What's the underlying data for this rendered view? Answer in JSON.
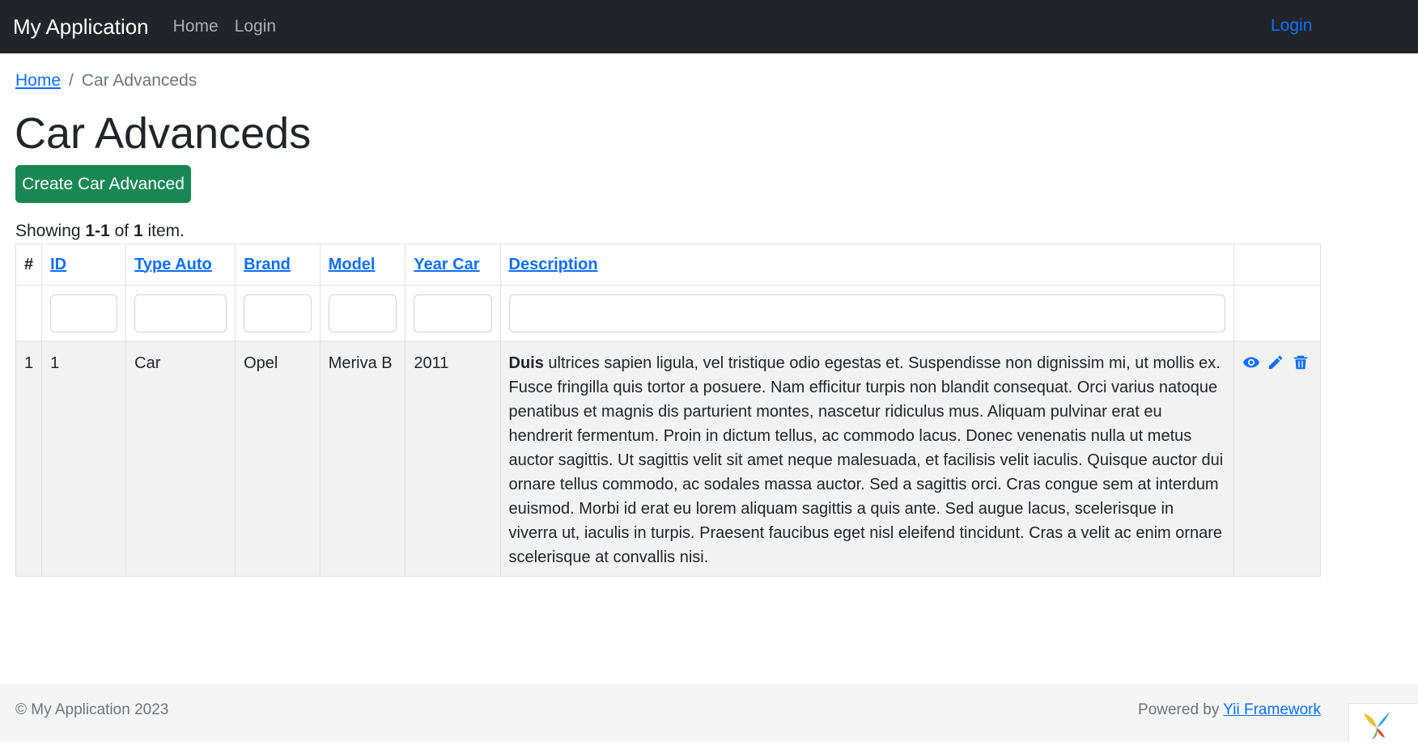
{
  "navbar": {
    "brand": "My Application",
    "links": [
      "Home",
      "Login"
    ],
    "right_login": "Login"
  },
  "breadcrumb": {
    "home": "Home",
    "separator": "/",
    "current": "Car Advanceds"
  },
  "page": {
    "title": "Car Advanceds",
    "create_button": "Create Car Advanced"
  },
  "summary": {
    "prefix": "Showing ",
    "range": "1-1",
    "middle": " of ",
    "total": "1",
    "suffix": " item."
  },
  "table": {
    "columns": [
      "#",
      "ID",
      "Type Auto",
      "Brand",
      "Model",
      "Year Car",
      "Description"
    ],
    "rows": [
      {
        "index": "1",
        "id": "1",
        "type_auto": "Car",
        "brand": "Opel",
        "model": "Meriva B",
        "year_car": "2011",
        "description_bold": "Duis",
        "description_rest": " ultrices sapien ligula, vel tristique odio egestas et. Suspendisse non dignissim mi, ut mollis ex. Fusce fringilla quis tortor a posuere. Nam efficitur turpis non blandit consequat. Orci varius natoque penatibus et magnis dis parturient montes, nascetur ridiculus mus. Aliquam pulvinar erat eu hendrerit fermentum. Proin in dictum tellus, ac commodo lacus. Donec venenatis nulla ut metus auctor sagittis. Ut sagittis velit sit amet neque malesuada, et facilisis velit iaculis. Quisque auctor dui ornare tellus commodo, ac sodales massa auctor. Sed a sagittis orci. Cras congue sem at interdum euismod. Morbi id erat eu lorem aliquam sagittis a quis ante. Sed augue lacus, scelerisque in viverra ut, iaculis in turpis. Praesent faucibus eget nisl eleifend tincidunt. Cras a velit ac enim ornare scelerisque at convallis nisi.",
        "actions": [
          "eye-icon",
          "pencil-icon",
          "trash-icon"
        ]
      }
    ]
  },
  "footer": {
    "copyright": "© My Application 2023",
    "powered_prefix": "Powered by ",
    "powered_link": "Yii Framework"
  },
  "colors": {
    "navbar_bg": "#212529",
    "link": "#0d6efd",
    "success": "#198754",
    "row_bg": "#f2f2f2",
    "footer_bg": "#f5f5f5"
  }
}
